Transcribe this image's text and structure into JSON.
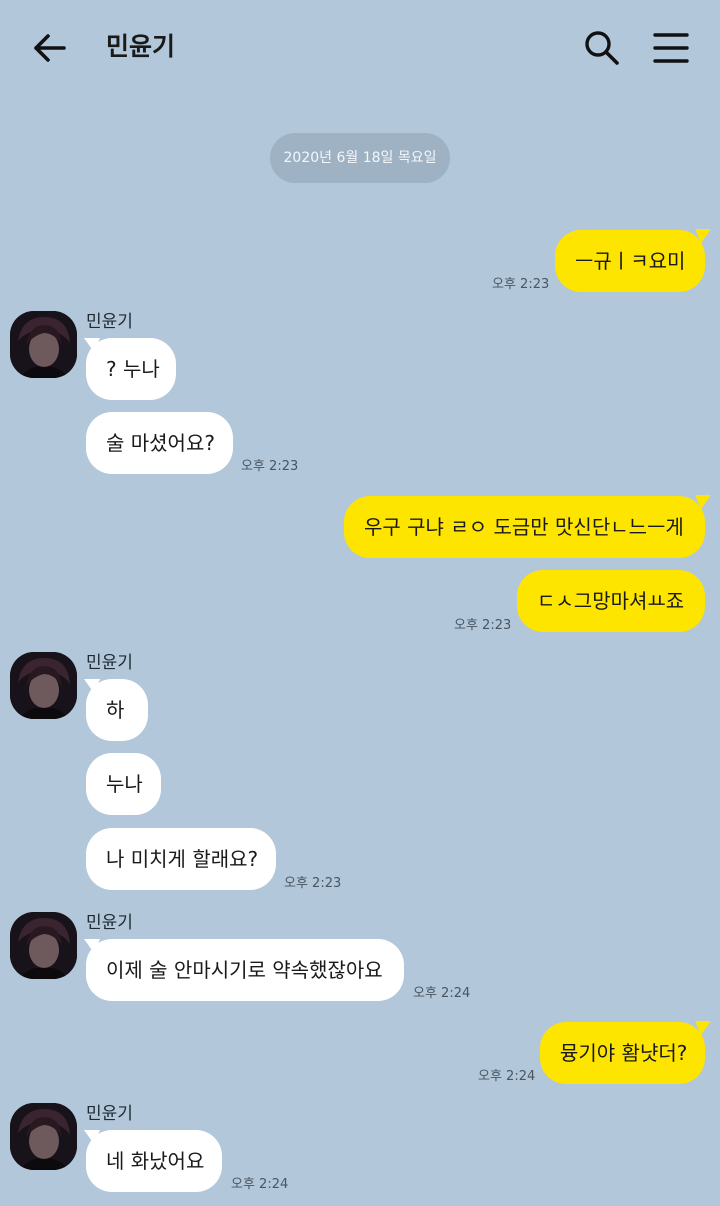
{
  "header": {
    "title": "민윤기",
    "back_icon": "arrow-left-icon",
    "search_icon": "search-icon",
    "menu_icon": "hamburger-menu-icon"
  },
  "date_divider": "2020년 6월 18일 목요일",
  "colors": {
    "background": "#b2c7da",
    "outgoing_bubble": "#fee500",
    "incoming_bubble": "#ffffff",
    "date_badge": "#9fb2c3"
  },
  "messages": [
    {
      "direction": "outgoing",
      "text": "ㅡ규ㅣㅋ요미",
      "time": "오후 2:23"
    },
    {
      "direction": "incoming",
      "sender": "민윤기",
      "text": "? 누나"
    },
    {
      "direction": "incoming",
      "text": "술 마셨어요?",
      "time": "오후 2:23"
    },
    {
      "direction": "outgoing",
      "text": "우구 구냐 ㄹㅇ 도금만 맛신단ㄴ느ㅡ게"
    },
    {
      "direction": "outgoing",
      "text": "ㄷㅅ그망마셔ㅛ죠",
      "time": "오후 2:23"
    },
    {
      "direction": "incoming",
      "sender": "민윤기",
      "text": "하"
    },
    {
      "direction": "incoming",
      "text": "누나"
    },
    {
      "direction": "incoming",
      "text": "나 미치게 할래요?",
      "time": "오후 2:23"
    },
    {
      "direction": "incoming",
      "sender": "민윤기",
      "text": "이제 술 안마시기로 약속했잖아요",
      "time": "오후 2:24"
    },
    {
      "direction": "outgoing",
      "text": "뮹기야 홤냣더?",
      "time": "오후 2:24"
    },
    {
      "direction": "incoming",
      "sender": "민윤기",
      "text": "네 화났어요",
      "time": "오후 2:24"
    }
  ]
}
